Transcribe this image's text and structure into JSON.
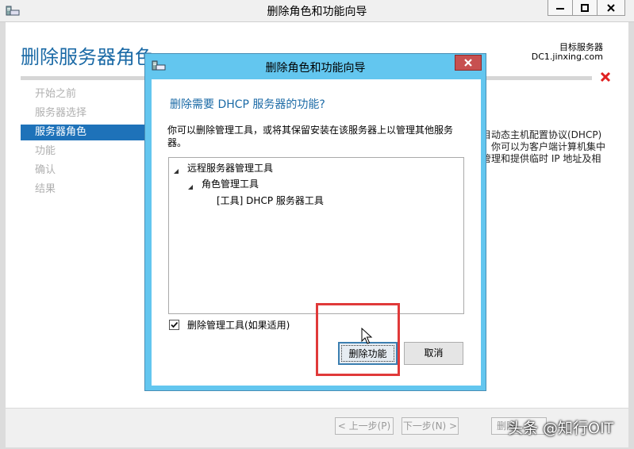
{
  "outer_window": {
    "title": "删除角色和功能向导",
    "page_heading": "删除服务器角色",
    "target_server_label": "目标服务器",
    "target_server_value": "DC1.jinxing.com",
    "nav_items": [
      "开始之前",
      "服务器选择",
      "服务器角色",
      "功能",
      "确认",
      "结果"
    ],
    "active_nav_index": 2,
    "description_lines": [
      "目动态主机配置协议(DHCP)",
      "，你可以为客户端计算机集中",
      "管理和提供临时 IP 地址及相"
    ],
    "footer_buttons": {
      "prev": "< 上一步(P)",
      "next": "下一步(N) >",
      "remove": "删除"
    }
  },
  "dialog": {
    "title": "删除角色和功能向导",
    "question": "删除需要 DHCP 服务器的功能?",
    "message": "你可以删除管理工具，或将其保留安装在该服务器上以管理其他服务器。",
    "tree": [
      {
        "label": "远程服务器管理工具",
        "level": 0,
        "expanded": true
      },
      {
        "label": "角色管理工具",
        "level": 1,
        "expanded": true
      },
      {
        "label": "[工具] DHCP 服务器工具",
        "level": 2,
        "expanded": false
      }
    ],
    "checkbox_label": "删除管理工具(如果适用)",
    "checkbox_checked": true,
    "primary_button": "删除功能",
    "cancel_button": "取消"
  },
  "watermark": "头条 @知行OIT",
  "colors": {
    "accent_blue": "#1b6aa6",
    "nav_active": "#1e72b9",
    "dialog_frame": "#63c6ef",
    "close_red": "#c75050",
    "highlight_red": "#e03a3a"
  }
}
